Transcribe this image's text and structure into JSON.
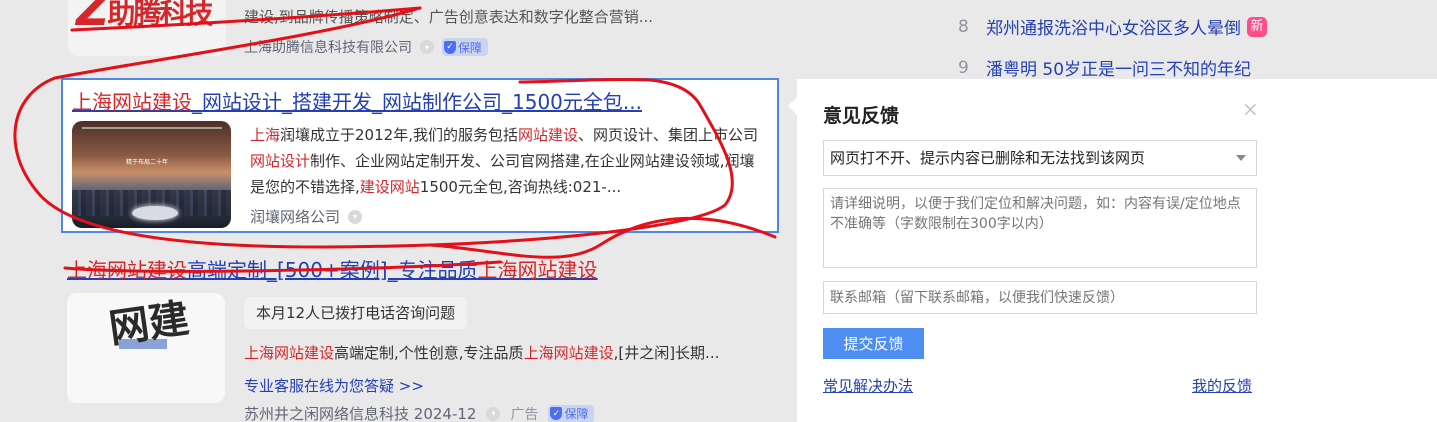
{
  "result1": {
    "logo_text": "助腾科技",
    "logo_mark": "Z",
    "description": "建设,到品牌传播策略制定、广告创意表达和数字化整合营销...",
    "source": "上海助腾信息科技有限公司",
    "guard_label": "保障"
  },
  "result2": {
    "title_hl": "上海网站建设",
    "title_rest": "_网站设计_搭建开发_网站制作公司_1500元全包...",
    "thumb_slogan": "精于布局二十年",
    "desc": [
      {
        "t": "上海",
        "hl": true
      },
      {
        "t": "润壤成立于2012年,我们的服务包括",
        "hl": false
      },
      {
        "t": "网站建设",
        "hl": true
      },
      {
        "t": "、网页设计、集团上市公司",
        "hl": false
      },
      {
        "t": "网站设计",
        "hl": true
      },
      {
        "t": "制作、企业网站定制开发、公司官网搭建,在企业网站建设领域,润壤是您的不错选择,",
        "hl": false
      },
      {
        "t": "建设网站",
        "hl": true
      },
      {
        "t": "1500元全包,咨询热线:021-...",
        "hl": false
      }
    ],
    "source": "润壤网络公司"
  },
  "result3": {
    "title_a": "上海网站建设",
    "title_b": "高端定制_[500+案例]_专注品质",
    "title_c": "上海网站建设",
    "thumb_logo": "网建",
    "pill": "本月12人已拨打电话咨询问题",
    "desc_a": "上海网站建设",
    "desc_b": "高端定制,个性创意,专注品质",
    "desc_c": "上海网站建设",
    "desc_d": ",[井之闲]长期...",
    "link": "专业客服在线为您答疑 >>",
    "source": "苏州井之闲网络信息科技 2024-12",
    "ad_label": "广告",
    "guard_label": "保障"
  },
  "hot_list": [
    {
      "num": "8",
      "text": "郑州通报洗浴中心女浴区多人晕倒",
      "badge": "新"
    },
    {
      "num": "9",
      "text": "潘粤明 50岁正是一问三不知的年纪",
      "badge": ""
    }
  ],
  "feedback": {
    "title": "意见反馈",
    "close": "×",
    "select_value": "网页打不开、提示内容已删除和无法找到该网页",
    "textarea_placeholder": "请详细说明，以便于我们定位和解决问题，如：内容有误/定位地点不准确等（字数限制在300字以内）",
    "email_placeholder": "联系邮箱（留下联系邮箱，以便我们快速反馈）",
    "submit_label": "提交反馈",
    "faq_label": "常见解决办法",
    "my_feedback_label": "我的反馈"
  }
}
